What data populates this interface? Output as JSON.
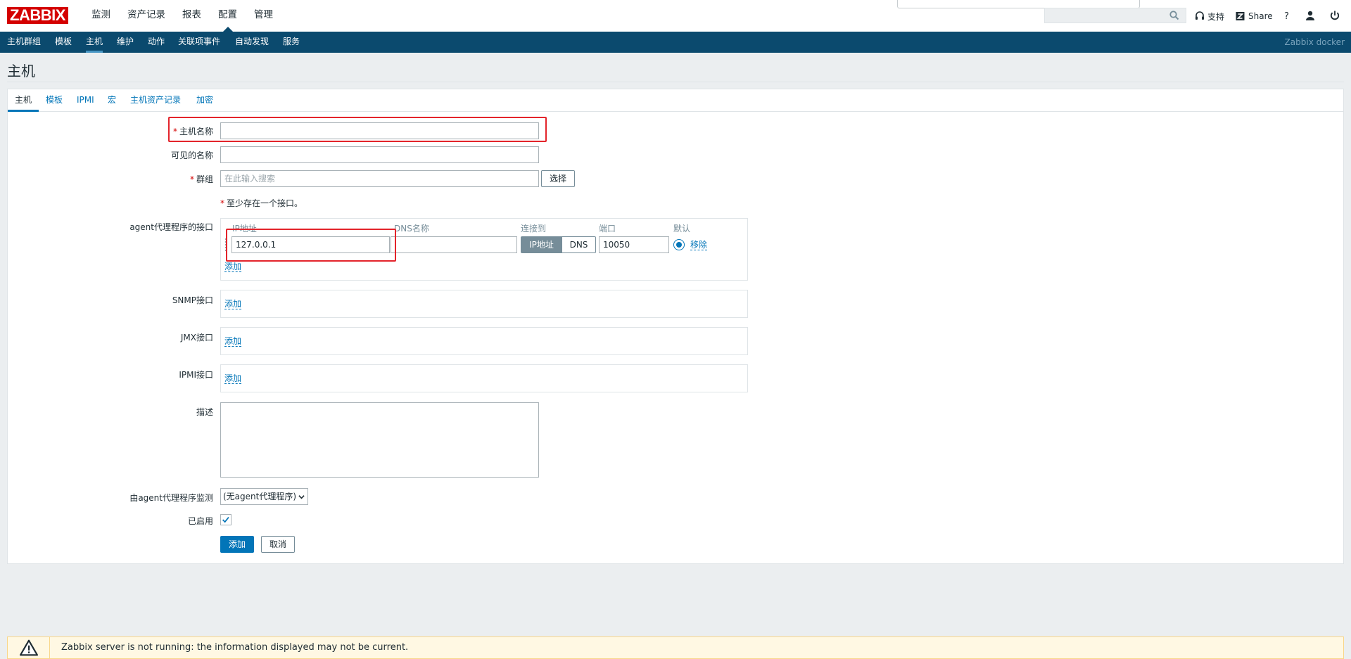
{
  "app": {
    "logo": "ZABBIX",
    "server_name": "Zabbix docker"
  },
  "main_menu": [
    {
      "label": "监测",
      "active": false
    },
    {
      "label": "资产记录",
      "active": false
    },
    {
      "label": "报表",
      "active": false
    },
    {
      "label": "配置",
      "active": true
    },
    {
      "label": "管理",
      "active": false
    }
  ],
  "top_right": {
    "support_label": "支持",
    "share_label": "Share",
    "help_label": "?"
  },
  "sub_menu": [
    {
      "label": "主机群组",
      "active": false
    },
    {
      "label": "模板",
      "active": false
    },
    {
      "label": "主机",
      "active": true
    },
    {
      "label": "维护",
      "active": false
    },
    {
      "label": "动作",
      "active": false
    },
    {
      "label": "关联项事件",
      "active": false
    },
    {
      "label": "自动发现",
      "active": false
    },
    {
      "label": "服务",
      "active": false
    }
  ],
  "page_title": "主机",
  "tabs": [
    {
      "label": "主机",
      "active": true
    },
    {
      "label": "模板",
      "active": false
    },
    {
      "label": "IPMI",
      "active": false
    },
    {
      "label": "宏",
      "active": false
    },
    {
      "label": "主机资产记录",
      "active": false
    },
    {
      "label": "加密",
      "active": false
    }
  ],
  "form": {
    "required_mark": "*",
    "host_name_label": "主机名称",
    "host_name_value": "",
    "visible_name_label": "可见的名称",
    "visible_name_value": "",
    "groups_label": "群组",
    "groups_placeholder": "在此输入搜索",
    "select_button": "选择",
    "interface_notice": "至少存在一个接口。",
    "agent_interfaces_label": "agent代理程序的接口",
    "interface_headers": {
      "ip": "IP地址",
      "dns": "DNS名称",
      "connect_to": "连接到",
      "port": "端口",
      "default": "默认"
    },
    "agent_interface": {
      "ip": "127.0.0.1",
      "dns": "",
      "connect_ip_label": "IP地址",
      "connect_dns_label": "DNS",
      "connect_selected": "IP地址",
      "port": "10050",
      "remove_label": "移除"
    },
    "add_link": "添加",
    "snmp_label": "SNMP接口",
    "jmx_label": "JMX接口",
    "ipmi_label": "IPMI接口",
    "description_label": "描述",
    "description_value": "",
    "monitored_by_label": "由agent代理程序监测",
    "monitored_by_value": "(无agent代理程序)",
    "enabled_label": "已启用",
    "enabled_checked": true,
    "add_button": "添加",
    "cancel_button": "取消"
  },
  "footer_warning": "Zabbix server is not running: the information displayed may not be current.",
  "colors": {
    "brand_red": "#d40000",
    "nav_blue": "#0b4a6e",
    "link_blue": "#0275b8",
    "annotation_red": "#e3242b"
  }
}
